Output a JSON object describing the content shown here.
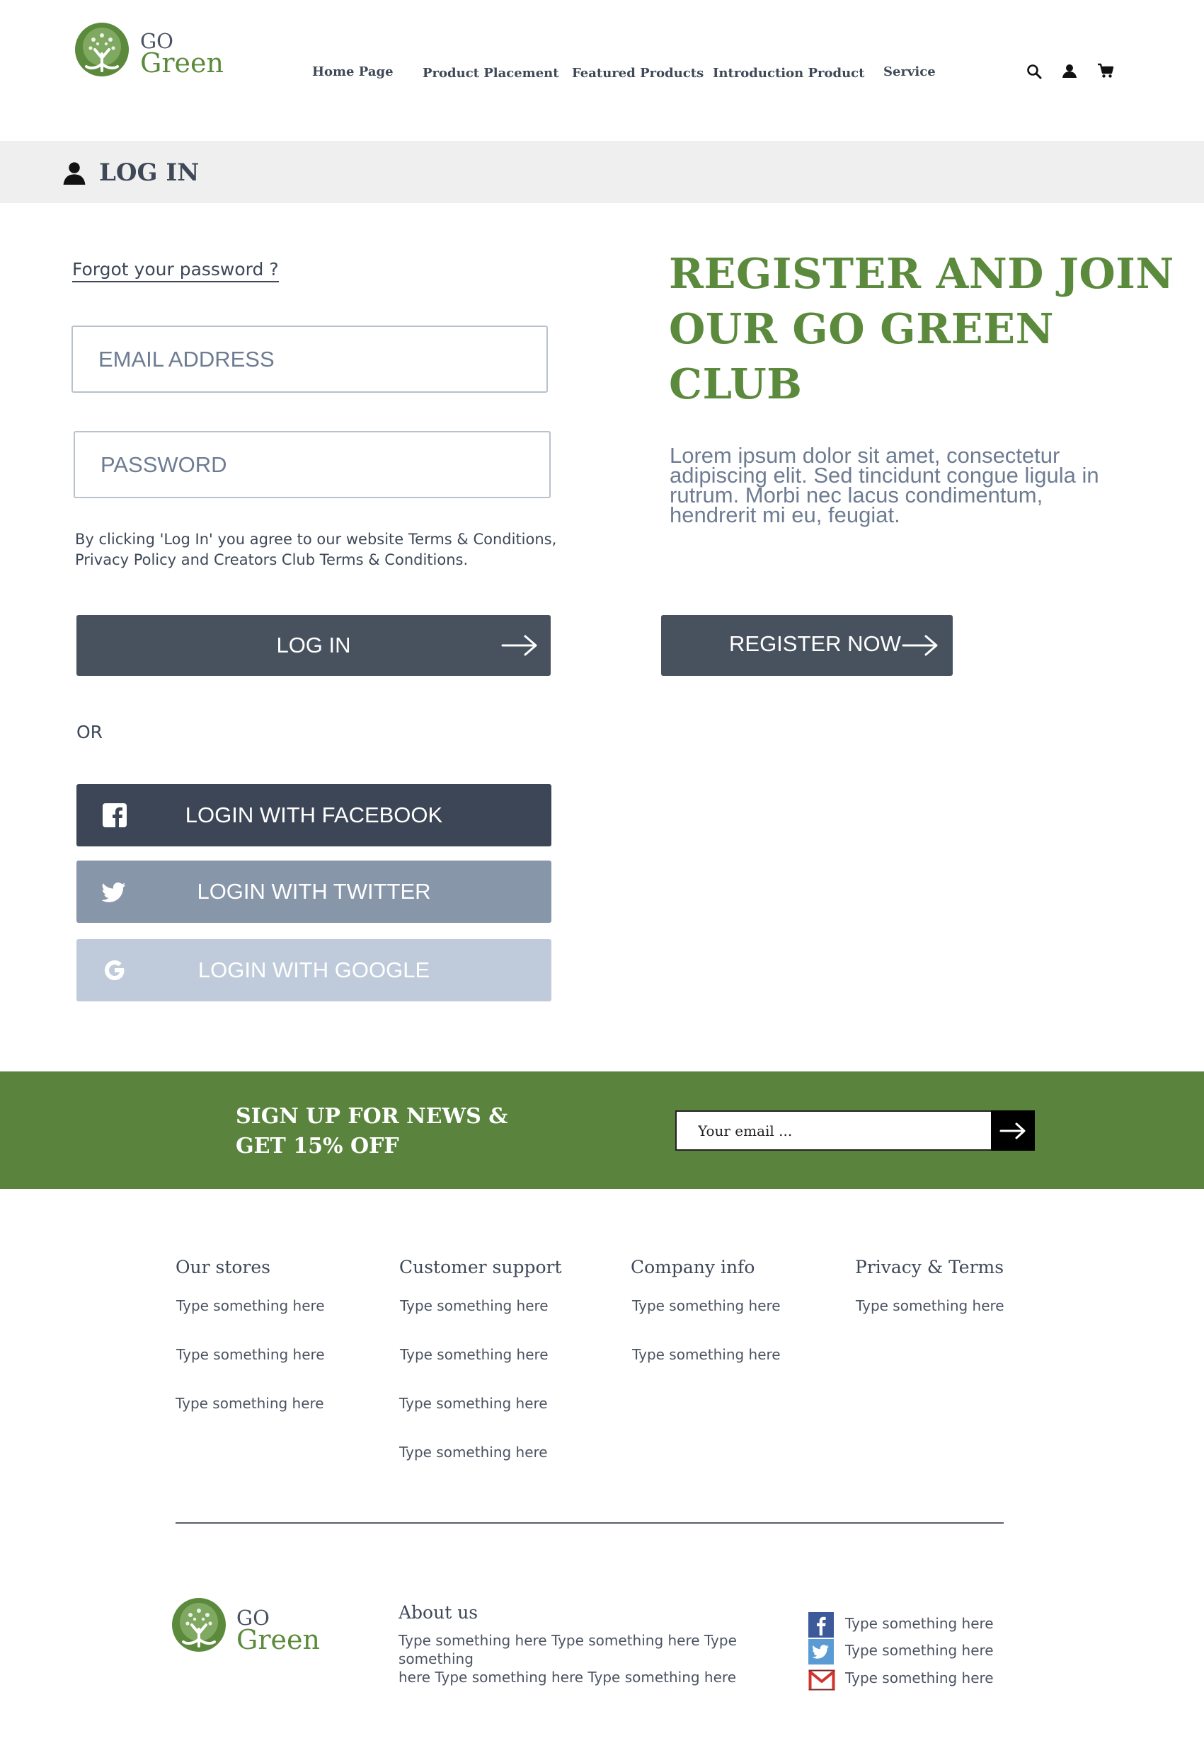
{
  "header": {
    "logo": {
      "line1": "GO",
      "line2": "Green"
    },
    "nav": [
      {
        "label": "Home Page"
      },
      {
        "label": "Product Placement"
      },
      {
        "label": "Featured Products"
      },
      {
        "label": "Introduction Product"
      },
      {
        "label": "Service"
      }
    ],
    "icons": [
      "search-icon",
      "user-icon",
      "cart-icon"
    ]
  },
  "login_band": {
    "title": "LOG IN",
    "icon": "user-icon"
  },
  "login_form": {
    "forgot_link": "Forgot your password ?",
    "email_placeholder": "EMAIL ADDRESS",
    "email_value": "",
    "password_placeholder": "PASSWORD",
    "password_value": "",
    "terms_line1": "By clicking 'Log In' you agree to our website Terms & Conditions,",
    "terms_line2": "Privacy Policy and Creators Club Terms & Conditions.",
    "login_button": "LOG IN",
    "or_text": "OR",
    "facebook_button": "LOGIN WITH FACEBOOK",
    "twitter_button": "LOGIN WITH TWITTER",
    "google_button": "LOGIN WITH GOOGLE"
  },
  "register": {
    "title_line1": "REGISTER AND JOIN",
    "title_line2": "OUR GO GREEN CLUB",
    "body_line1": "Lorem ipsum dolor sit amet, consectetur",
    "body_line2": "adipiscing elit. Sed tincidunt congue ligula in",
    "body_line3": "rutrum. Morbi nec lacus condimentum,",
    "body_line4": "hendrerit mi eu, feugiat.",
    "button": "REGISTER NOW"
  },
  "newsletter": {
    "line1": "SIGN UP FOR NEWS &",
    "line2": "GET 15% OFF",
    "email_placeholder": "Your email ...",
    "email_value": ""
  },
  "footer": {
    "columns": [
      {
        "title": "Our stores",
        "links": [
          "Type something here",
          "Type something here",
          "Type something here"
        ]
      },
      {
        "title": "Customer support",
        "links": [
          "Type something here",
          "Type something here",
          "Type something here",
          "Type something here"
        ]
      },
      {
        "title": "Company info",
        "links": [
          "Type something here",
          "Type something here"
        ]
      },
      {
        "title": "Privacy & Terms",
        "links": [
          "Type something here"
        ]
      }
    ],
    "logo": {
      "line1": "GO",
      "line2": "Green"
    },
    "about_title": "About us",
    "about_line1": "Type something here Type something here Type something",
    "about_line2": "here Type something here Type something here",
    "social": [
      {
        "icon": "facebook-icon",
        "label": "Type something here"
      },
      {
        "icon": "twitter-icon",
        "label": "Type something here"
      },
      {
        "icon": "gmail-icon",
        "label": "Type something here"
      }
    ]
  },
  "colors": {
    "brand_green": "#5b8a3c",
    "newsletter_green": "#5a843e",
    "dark_button": "#48525f",
    "facebook_button": "#3d4656",
    "twitter_button": "#8896aa",
    "google_button": "#bfcbda"
  }
}
